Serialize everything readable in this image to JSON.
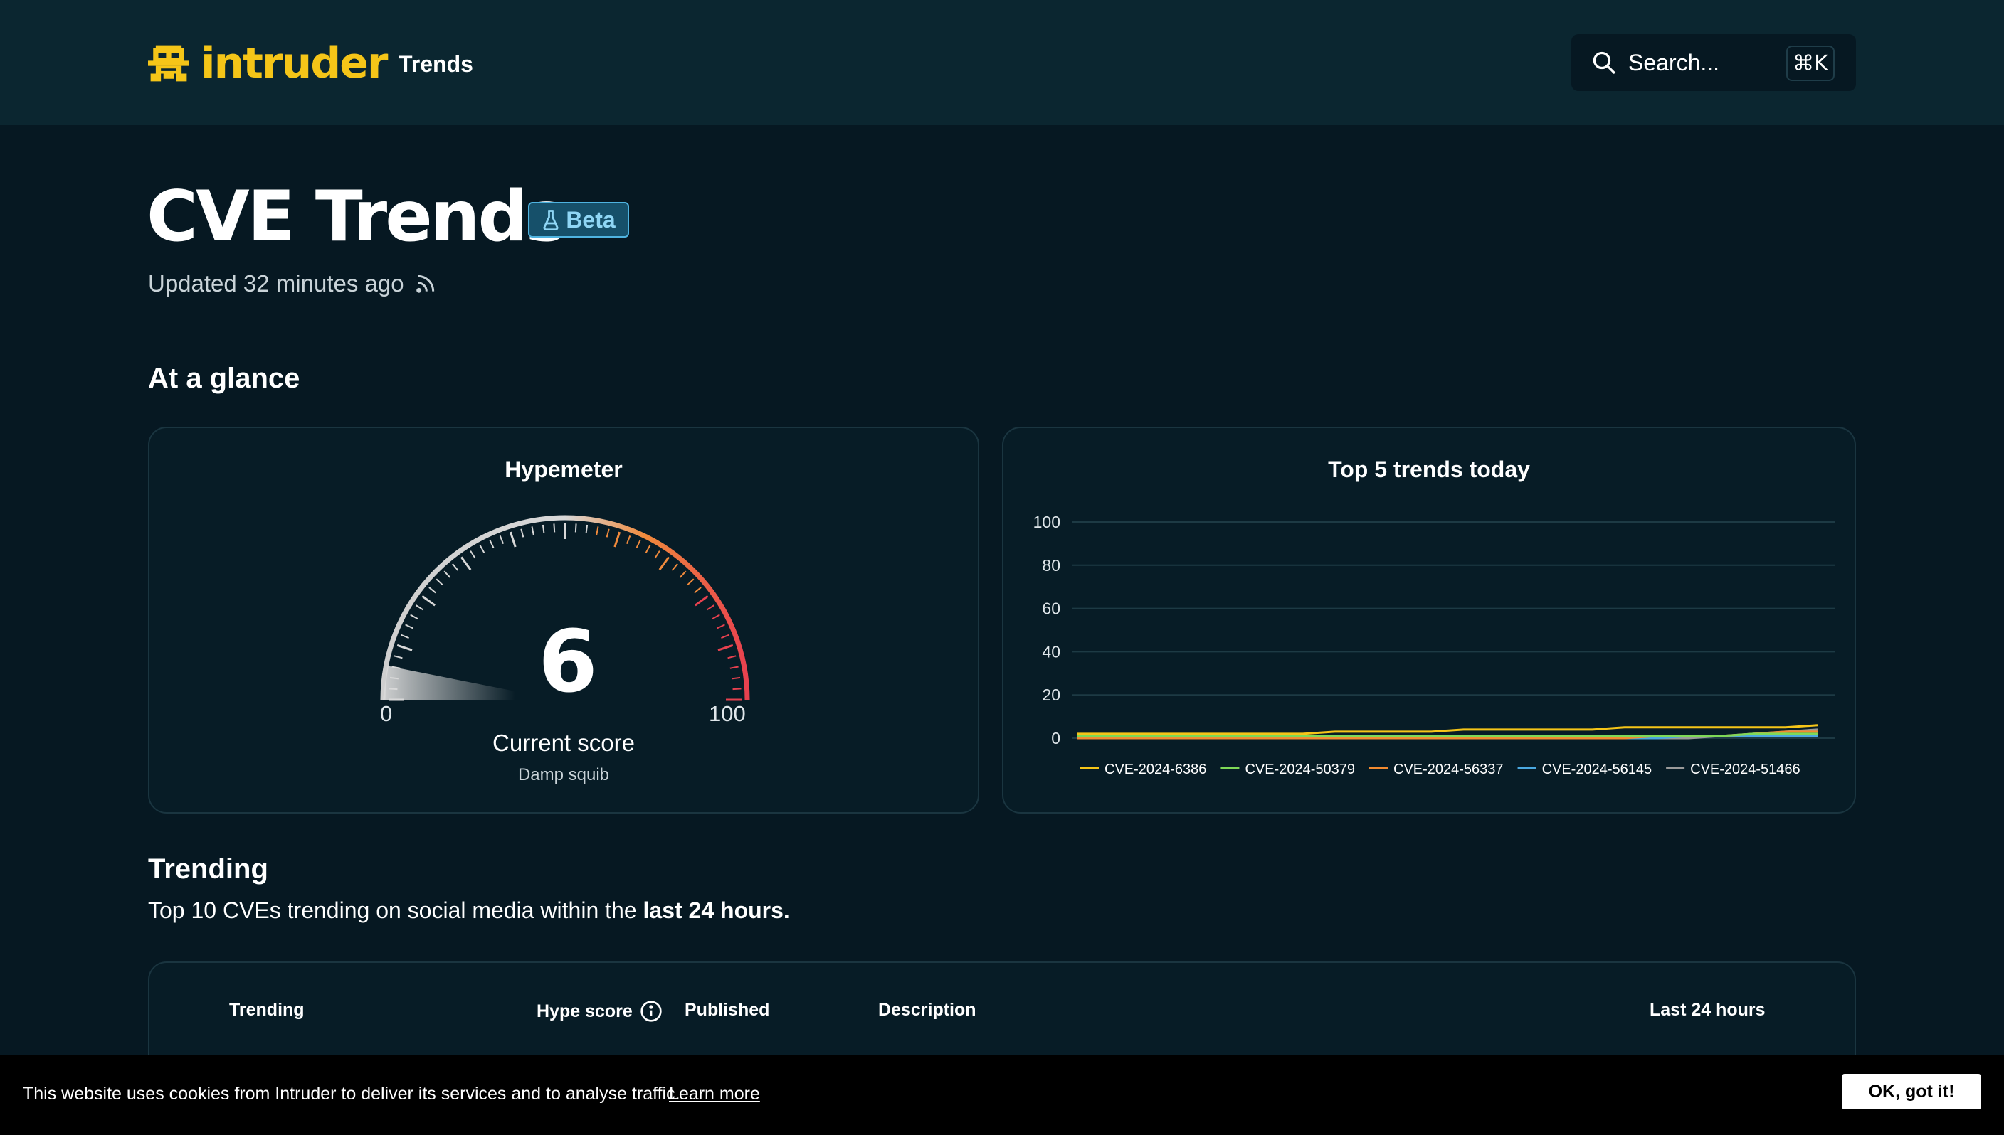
{
  "header": {
    "logo_text": "intruder",
    "nav_trends": "Trends",
    "search_placeholder": "Search...",
    "search_shortcut": "⌘K"
  },
  "page": {
    "title": "CVE Trends",
    "badge": "Beta",
    "updated": "Updated 32 minutes ago"
  },
  "glance": {
    "heading": "At a glance",
    "hypemeter": {
      "title": "Hypemeter",
      "score": "6",
      "score_value": 6,
      "min": "0",
      "max": "100",
      "label": "Current score",
      "sublabel": "Damp squib"
    },
    "top5_title": "Top 5 trends today"
  },
  "chart_data": {
    "type": "line",
    "title": "Top 5 trends today",
    "y_ticks": [
      "0",
      "20",
      "40",
      "60",
      "80",
      "100"
    ],
    "ylim": [
      0,
      100
    ],
    "grid": true,
    "legend_position": "bottom",
    "x": [
      0,
      1,
      2,
      3,
      4,
      5,
      6,
      7,
      8,
      9,
      10,
      11,
      12,
      13,
      14,
      15,
      16,
      17,
      18,
      19,
      20,
      21,
      22,
      23
    ],
    "series": [
      {
        "name": "CVE-2024-6386",
        "color": "#f5c518",
        "values": [
          2,
          2,
          2,
          2,
          2,
          2,
          2,
          2,
          3,
          3,
          3,
          3,
          4,
          4,
          4,
          4,
          4,
          5,
          5,
          5,
          5,
          5,
          5,
          6
        ]
      },
      {
        "name": "CVE-2024-50379",
        "color": "#7ed957",
        "values": [
          1,
          1,
          1,
          1,
          1,
          1,
          1,
          1,
          1,
          1,
          1,
          1,
          1,
          1,
          1,
          1,
          1,
          1,
          1,
          1,
          1,
          2,
          2,
          2
        ]
      },
      {
        "name": "CVE-2024-56337",
        "color": "#f28b30",
        "values": [
          0,
          0,
          0,
          0,
          0,
          0,
          0,
          0,
          0,
          0,
          0,
          0,
          0,
          0,
          0,
          0,
          0,
          0,
          1,
          1,
          1,
          2,
          3,
          3
        ]
      },
      {
        "name": "CVE-2024-56145",
        "color": "#4aa8e0",
        "values": [
          0,
          0,
          0,
          0,
          0,
          0,
          0,
          0,
          0,
          0,
          0,
          0,
          0,
          0,
          0,
          0,
          0,
          0,
          0,
          1,
          1,
          1,
          1,
          1
        ]
      },
      {
        "name": "CVE-2024-51466",
        "color": "#9a9a9a",
        "values": [
          0,
          0,
          0,
          0,
          0,
          0,
          0,
          0,
          0,
          0,
          0,
          0,
          0,
          0,
          0,
          0,
          0,
          0,
          0,
          0,
          1,
          2,
          3,
          4
        ]
      }
    ]
  },
  "trending": {
    "heading": "Trending",
    "desc_prefix": "Top 10 CVEs trending on social media within the ",
    "desc_bold": "last 24 hours.",
    "columns": [
      "Trending",
      "Hype score",
      "Published",
      "Description",
      "Last 24 hours"
    ]
  },
  "cookie": {
    "text": "This website uses cookies from Intruder to deliver its services and to analyse traffic.",
    "link": "Learn more",
    "button": "OK, got it!"
  },
  "colors": {
    "background": "#061822",
    "header": "#0b2630",
    "brand": "#f5c518",
    "beta_bg": "#16506a",
    "beta_border": "#4fb3e0"
  }
}
